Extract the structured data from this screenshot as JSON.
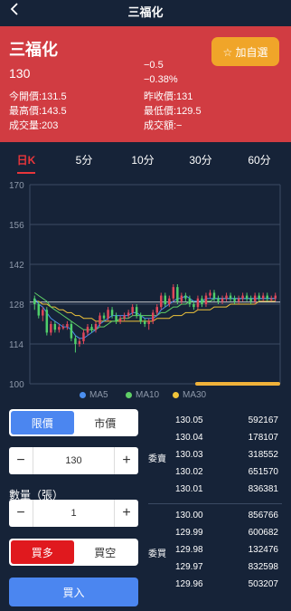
{
  "header": {
    "title": "三福化",
    "back_icon": "chevron-left-icon"
  },
  "quote": {
    "name": "三福化",
    "price": "130",
    "change": "−0.5",
    "change_pct": "−0.38%",
    "watch_label": "☆ 加自選",
    "open": "今開價:131.5",
    "prev_close": "昨收價:131",
    "high": "最高價:143.5",
    "low": "最低價:129.5",
    "volume": "成交量:203",
    "turnover": "成交額:−",
    "bg_color": "#d13c42",
    "watch_color": "#f0a529"
  },
  "tabs": [
    "日K",
    "5分",
    "10分",
    "30分",
    "60分"
  ],
  "active_tab": "日K",
  "chart_data": {
    "type": "candlestick",
    "yticks": [
      170,
      156,
      142,
      128,
      114,
      100
    ],
    "ylim": [
      100,
      170
    ],
    "grid": true,
    "legend": [
      "MA5",
      "MA10",
      "MA30"
    ],
    "legend_colors": [
      "#4b8ff0",
      "#5fcf67",
      "#f0c43a"
    ],
    "candles": [
      [
        130,
        128,
        131,
        126
      ],
      [
        128,
        124,
        129,
        123
      ],
      [
        124,
        126,
        127,
        122
      ],
      [
        126,
        118,
        127,
        117
      ],
      [
        118,
        121,
        122,
        117
      ],
      [
        121,
        119,
        122,
        118
      ],
      [
        119,
        120,
        121,
        118
      ],
      [
        120,
        120,
        121,
        119
      ],
      [
        120,
        121,
        122,
        119
      ],
      [
        121,
        116,
        122,
        115
      ],
      [
        116,
        114,
        117,
        111
      ],
      [
        114,
        115,
        116,
        113
      ],
      [
        115,
        118,
        119,
        114
      ],
      [
        118,
        120,
        121,
        117
      ],
      [
        120,
        119,
        121,
        118
      ],
      [
        119,
        121,
        122,
        118
      ],
      [
        121,
        124,
        125,
        120
      ],
      [
        124,
        123,
        125,
        122
      ],
      [
        123,
        126,
        127,
        122
      ],
      [
        126,
        124,
        127,
        123
      ],
      [
        124,
        122,
        125,
        121
      ],
      [
        122,
        123,
        124,
        121
      ],
      [
        123,
        124,
        125,
        122
      ],
      [
        124,
        125,
        126,
        123
      ],
      [
        125,
        127,
        128,
        124
      ],
      [
        127,
        124,
        128,
        123
      ],
      [
        124,
        122,
        125,
        121
      ],
      [
        122,
        121,
        123,
        120
      ],
      [
        121,
        122,
        123,
        119
      ],
      [
        122,
        125,
        126,
        121
      ],
      [
        125,
        127,
        128,
        124
      ],
      [
        127,
        131,
        132,
        126
      ],
      [
        131,
        128,
        132,
        127
      ],
      [
        128,
        130,
        131,
        127
      ],
      [
        130,
        134,
        135,
        129
      ],
      [
        134,
        129,
        135,
        128
      ],
      [
        129,
        131,
        132,
        128
      ],
      [
        131,
        130,
        132,
        129
      ],
      [
        130,
        128,
        131,
        127
      ],
      [
        128,
        127,
        129,
        126
      ],
      [
        127,
        130,
        131,
        126
      ],
      [
        130,
        128,
        131,
        127
      ],
      [
        128,
        131,
        132,
        127
      ],
      [
        131,
        132,
        133,
        130
      ],
      [
        132,
        130,
        133,
        129
      ],
      [
        130,
        129,
        131,
        128
      ],
      [
        129,
        130,
        131,
        128
      ],
      [
        130,
        131,
        132,
        129
      ],
      [
        131,
        130,
        132,
        129
      ],
      [
        130,
        129,
        131,
        128
      ],
      [
        129,
        130,
        131,
        128
      ],
      [
        130,
        131,
        132,
        129
      ],
      [
        131,
        130,
        132,
        129
      ],
      [
        130,
        129,
        131,
        128
      ],
      [
        129,
        131,
        132,
        128
      ],
      [
        131,
        130,
        132,
        129
      ],
      [
        130,
        131,
        132,
        129
      ],
      [
        131,
        130,
        132,
        129
      ],
      [
        130,
        130,
        131,
        129
      ],
      [
        130,
        131,
        132,
        129
      ]
    ],
    "ma5": [
      130,
      128,
      127,
      125,
      123,
      122,
      121,
      120,
      120,
      119,
      117,
      116,
      116,
      117,
      118,
      119,
      121,
      122,
      123,
      124,
      124,
      124,
      124,
      124,
      125,
      125,
      124,
      123,
      123,
      123,
      124,
      126,
      127,
      128,
      129,
      130,
      130,
      131,
      130,
      129,
      129,
      129,
      130,
      130,
      130,
      130,
      130,
      130,
      130,
      130,
      130,
      130,
      130,
      130,
      130,
      130,
      130,
      130,
      130,
      130
    ],
    "ma10": [
      132,
      131,
      130,
      129,
      127,
      126,
      125,
      124,
      123,
      122,
      121,
      120,
      119,
      119,
      119,
      119,
      120,
      120,
      121,
      122,
      122,
      123,
      123,
      123,
      124,
      124,
      124,
      124,
      124,
      124,
      124,
      125,
      125,
      126,
      127,
      127,
      128,
      128,
      129,
      129,
      129,
      129,
      129,
      129,
      130,
      130,
      130,
      130,
      130,
      130,
      130,
      130,
      130,
      130,
      130,
      130,
      130,
      130,
      130,
      130
    ],
    "ma30": [
      129,
      129,
      128,
      128,
      127,
      127,
      126,
      126,
      125,
      125,
      124,
      124,
      123,
      123,
      123,
      122,
      122,
      122,
      122,
      122,
      122,
      122,
      122,
      122,
      122,
      122,
      122,
      122,
      122,
      122,
      123,
      123,
      123,
      123,
      124,
      124,
      124,
      125,
      125,
      125,
      126,
      126,
      126,
      126,
      127,
      127,
      127,
      127,
      128,
      128,
      128,
      128,
      128,
      128,
      128,
      129,
      129,
      129,
      129,
      129
    ]
  },
  "order_type": {
    "limit": "限價",
    "market": "市價",
    "active": "limit"
  },
  "price_input": {
    "minus": "−",
    "value": "130",
    "plus": "+"
  },
  "quantity": {
    "label": "數量（張）",
    "minus": "−",
    "value": "1",
    "plus": "+"
  },
  "side": {
    "long": "買多",
    "short": "買空",
    "active": "long"
  },
  "submit_label": "買入",
  "order_book": {
    "ask_label": "委賣",
    "bid_label": "委買",
    "asks": [
      {
        "price": "130.05",
        "vol": "592167"
      },
      {
        "price": "130.04",
        "vol": "178107"
      },
      {
        "price": "130.03",
        "vol": "318552"
      },
      {
        "price": "130.02",
        "vol": "651570"
      },
      {
        "price": "130.01",
        "vol": "836381"
      }
    ],
    "bids": [
      {
        "price": "130.00",
        "vol": "856766"
      },
      {
        "price": "129.99",
        "vol": "600682"
      },
      {
        "price": "129.98",
        "vol": "132476"
      },
      {
        "price": "129.97",
        "vol": "832598"
      },
      {
        "price": "129.96",
        "vol": "503207"
      }
    ]
  }
}
